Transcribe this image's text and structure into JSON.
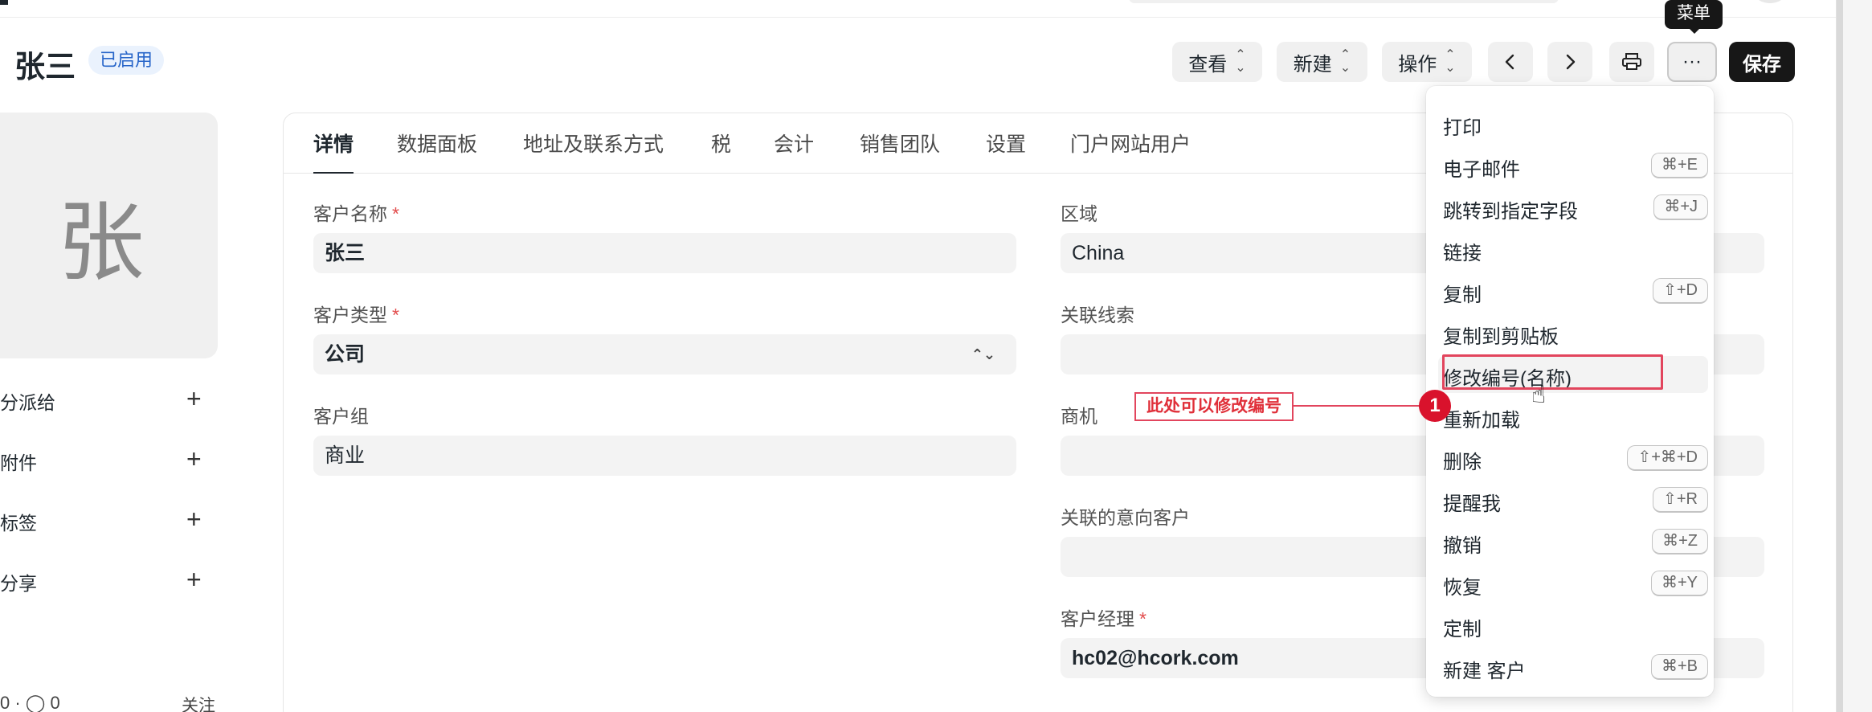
{
  "header": {
    "title": "张三",
    "status": "已启用",
    "buttons": {
      "view": "查看",
      "new": "新建",
      "action": "操作",
      "save": "保存",
      "more": "···"
    },
    "tooltip": "菜单"
  },
  "sidebar": {
    "avatar_letter": "张",
    "items": [
      {
        "label": "分派给",
        "icon": "plus-icon"
      },
      {
        "label": "附件",
        "icon": "plus-icon"
      },
      {
        "label": "标签",
        "icon": "plus-icon"
      },
      {
        "label": "分享",
        "icon": "plus-icon"
      }
    ],
    "stats": "0 · ◯ 0",
    "follow": "关注"
  },
  "tabs": [
    "详情",
    "数据面板",
    "地址及联系方式",
    "税",
    "会计",
    "销售团队",
    "设置",
    "门户网站用户"
  ],
  "form": {
    "customer_name": {
      "label": "客户名称",
      "value": "张三",
      "required": "*"
    },
    "customer_type": {
      "label": "客户类型",
      "value": "公司",
      "required": "*"
    },
    "customer_group": {
      "label": "客户组",
      "value": "商业"
    },
    "territory": {
      "label": "区域",
      "value": "China"
    },
    "lead": {
      "label": "关联线索",
      "value": ""
    },
    "opportunity": {
      "label": "商机",
      "value": ""
    },
    "prospect": {
      "label": "关联的意向客户",
      "value": ""
    },
    "account_manager": {
      "label": "客户经理",
      "value": "hc02@hcork.com",
      "required": "*"
    }
  },
  "annotation": {
    "text": "此处可以修改编号",
    "number": "1"
  },
  "menu": {
    "items": [
      {
        "label": "打印",
        "shortcut": ""
      },
      {
        "label": "电子邮件",
        "shortcut": "⌘+E"
      },
      {
        "label": "跳转到指定字段",
        "shortcut": "⌘+J"
      },
      {
        "label": "链接",
        "shortcut": ""
      },
      {
        "label": "复制",
        "shortcut": "⇧+D"
      },
      {
        "label": "复制到剪贴板",
        "shortcut": ""
      },
      {
        "label": "修改编号(名称)",
        "shortcut": ""
      },
      {
        "label": "重新加载",
        "shortcut": ""
      },
      {
        "label": "删除",
        "shortcut": "⇧+⌘+D"
      },
      {
        "label": "提醒我",
        "shortcut": "⇧+R"
      },
      {
        "label": "撤销",
        "shortcut": "⌘+Z"
      },
      {
        "label": "恢复",
        "shortcut": "⌘+Y"
      },
      {
        "label": "定制",
        "shortcut": ""
      },
      {
        "label": "新建 客户",
        "shortcut": "⌘+B"
      }
    ]
  },
  "colors": {
    "accent": "#171717",
    "badge_bg": "#eaf2fd",
    "badge_text": "#2765c9",
    "annotation": "#e2455d"
  }
}
